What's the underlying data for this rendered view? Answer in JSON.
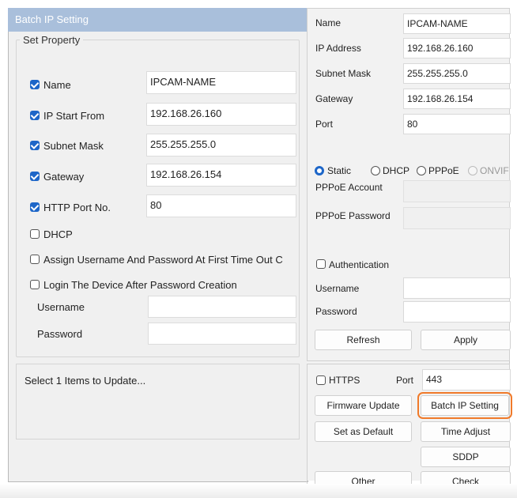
{
  "dialog": {
    "title": "Batch IP Setting",
    "group_legend": "Set Property",
    "rows": [
      {
        "label": "Name",
        "checked": true,
        "value": "IPCAM-NAME"
      },
      {
        "label": "IP Start From",
        "checked": true,
        "value": "192.168.26.160"
      },
      {
        "label": "Subnet Mask",
        "checked": true,
        "value": "255.255.255.0"
      },
      {
        "label": "Gateway",
        "checked": true,
        "value": "192.168.26.154"
      },
      {
        "label": "HTTP Port No.",
        "checked": true,
        "value": "80"
      }
    ],
    "dhcp_label": "DHCP",
    "assign_label": "Assign Username And Password At First Time Out C",
    "login_label": "Login The Device After Password Creation",
    "username_label": "Username",
    "username_value": "",
    "password_label": "Password",
    "password_value": "",
    "status_text": "Select 1 Items to Update..."
  },
  "right": {
    "name_label": "Name",
    "name_value": "IPCAM-NAME",
    "ip_label": "IP Address",
    "ip_value": "192.168.26.160",
    "mask_label": "Subnet Mask",
    "mask_value": "255.255.255.0",
    "gateway_label": "Gateway",
    "gateway_value": "192.168.26.154",
    "port_label": "Port",
    "port_value": "80",
    "modes": [
      {
        "label": "Static",
        "state": "selected"
      },
      {
        "label": "DHCP",
        "state": "unselected"
      },
      {
        "label": "PPPoE",
        "state": "unselected"
      },
      {
        "label": "ONVIF",
        "state": "disabled"
      }
    ],
    "pppoe_account_label": "PPPoE Account",
    "pppoe_password_label": "PPPoE Password",
    "auth_label": "Authentication",
    "username_label": "Username",
    "password_label": "Password",
    "refresh_label": "Refresh",
    "apply_label": "Apply",
    "https_label": "HTTPS",
    "https_port_label": "Port",
    "https_port_value": "443",
    "buttons": {
      "firmware_update": "Firmware Update",
      "batch_ip_setting": "Batch IP Setting",
      "set_as_default": "Set as Default",
      "time_adjust": "Time Adjust",
      "sddp": "SDDP",
      "other": "Other",
      "check": "Check"
    }
  },
  "colors": {
    "title_bar": "#a9bfdb",
    "checkbox_checked": "#1d66c8",
    "highlight_outline": "#f07a2a"
  }
}
